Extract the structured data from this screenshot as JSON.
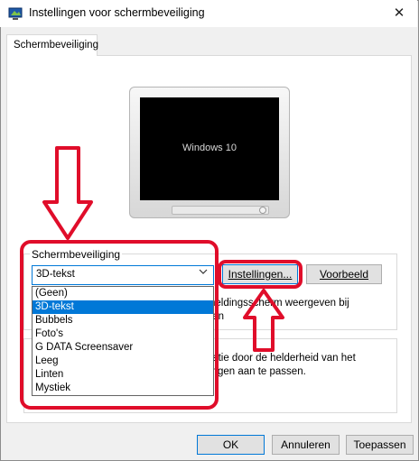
{
  "window": {
    "title": "Instellingen voor schermbeveiliging",
    "close_glyph": "✕"
  },
  "tab": {
    "label": "Schermbeveiliging"
  },
  "preview": {
    "screen_text": "Windows 10"
  },
  "screensaver_group": {
    "label": "Schermbeveiliging",
    "selected": "3D-tekst",
    "settings_button": "Instellingen...",
    "preview_button": "Voorbeeld",
    "wait_text": "heldingsscherm weergeven bij\nten"
  },
  "dropdown": {
    "options": [
      "(Geen)",
      "3D-tekst",
      "Bubbels",
      "Foto's",
      "G DATA Screensaver",
      "Leeg",
      "Linten",
      "Mystiek"
    ],
    "selected_index": 1
  },
  "power_group": {
    "text": "tatie door de helderheid van het\ningen aan te passen."
  },
  "footer": {
    "ok": "OK",
    "cancel": "Annuleren",
    "apply": "Toepassen"
  },
  "annotation": {
    "color": "#e00d2a"
  }
}
